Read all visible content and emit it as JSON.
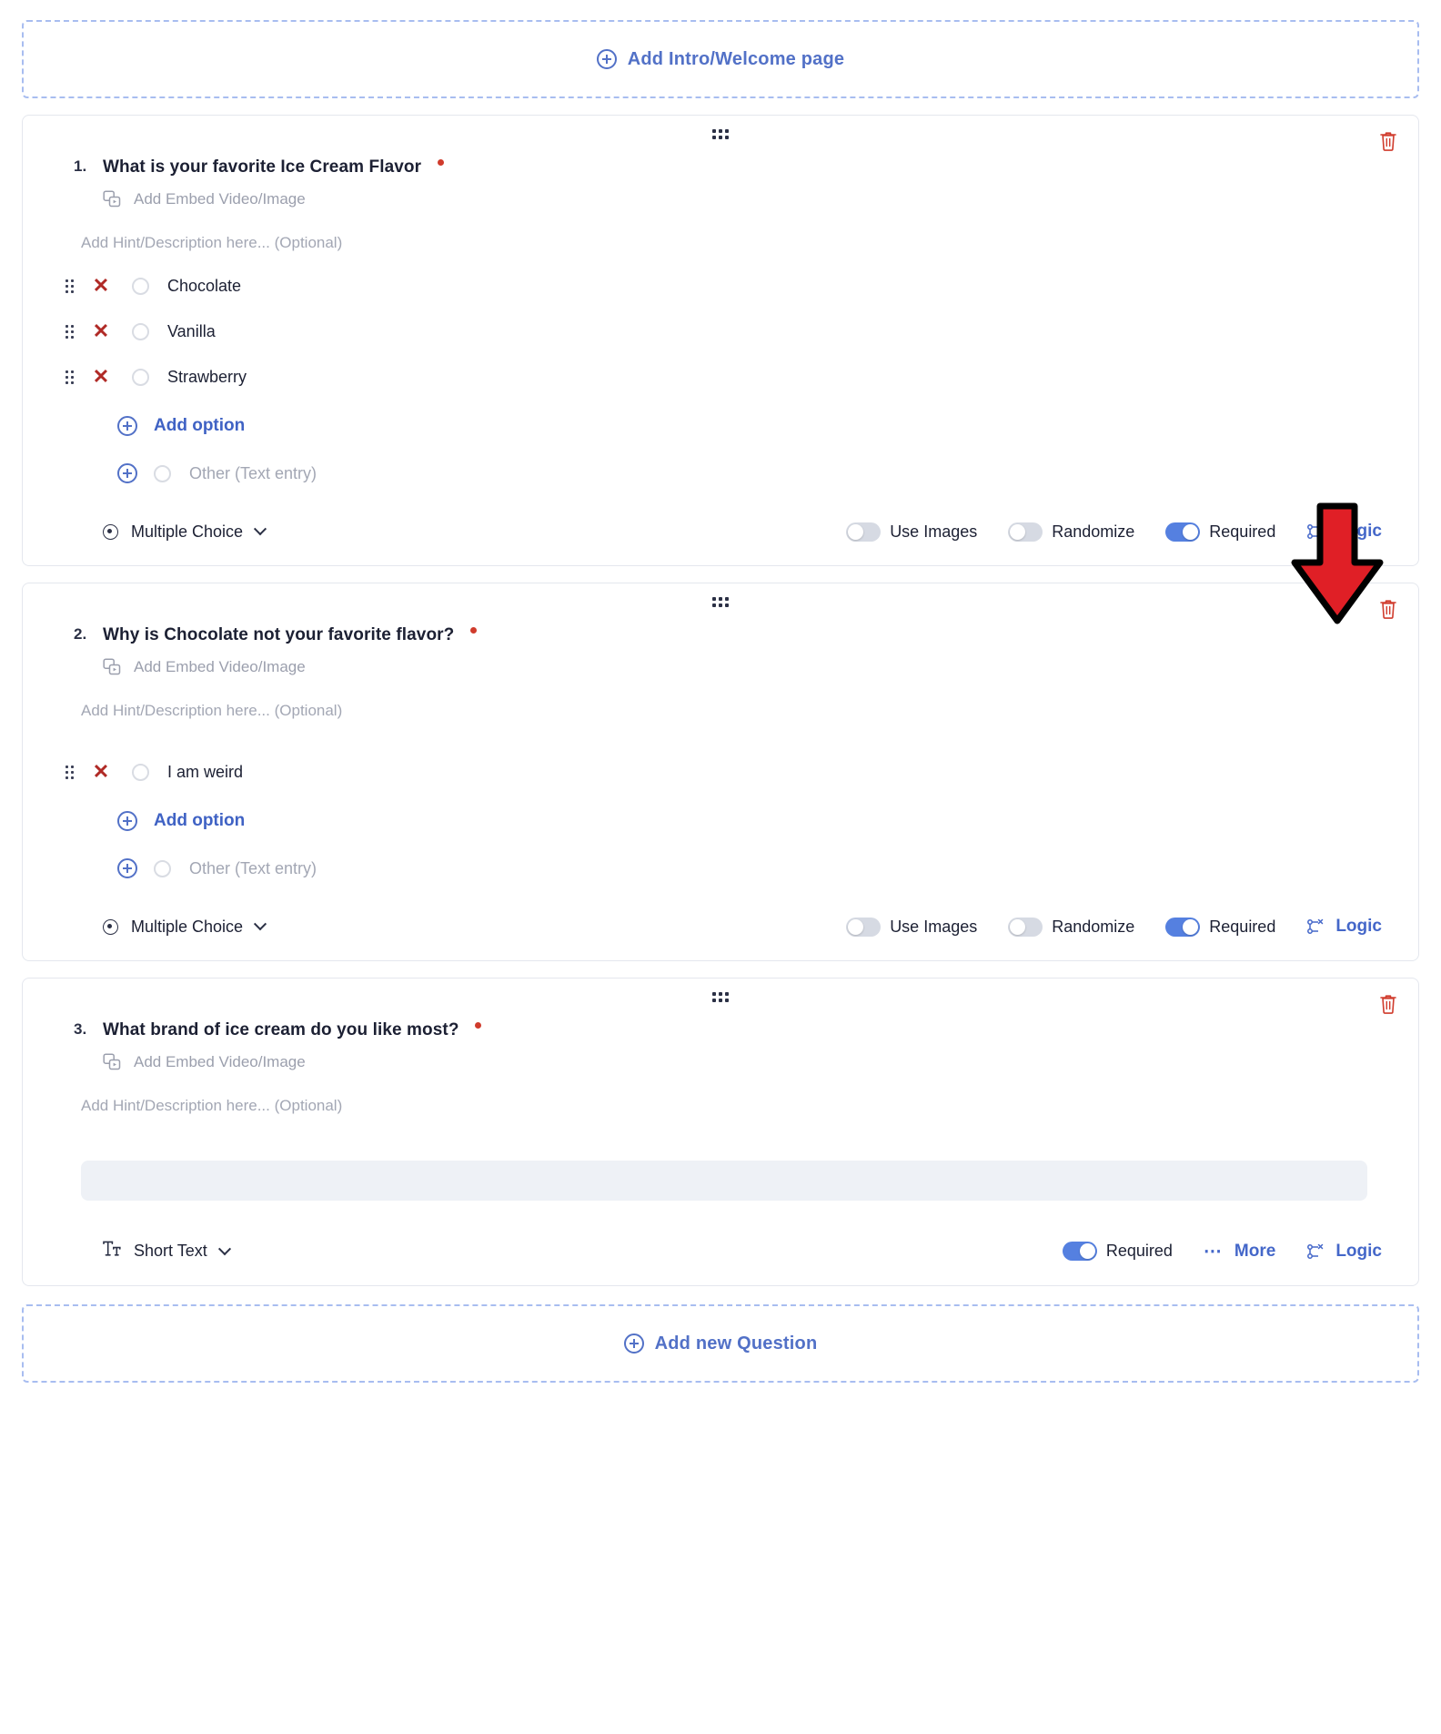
{
  "intro_bar": {
    "label": "Add Intro/Welcome page",
    "icon": "plus-circle-icon"
  },
  "footer_bar": {
    "label": "Add new Question",
    "icon": "plus-circle-icon"
  },
  "common": {
    "embed_label": "Add Embed Video/Image",
    "hint_placeholder": "Add Hint/Description here... (Optional)",
    "add_option_label": "Add option",
    "other_label": "Other (Text entry)",
    "use_images_label": "Use Images",
    "randomize_label": "Randomize",
    "required_label": "Required",
    "logic_label": "Logic",
    "more_label": "More",
    "drag_icon": "drag-handle-icon",
    "delete_icon": "trash-icon",
    "remove_option_icon": "close-x-icon",
    "logic_icon": "logic-branch-icon",
    "embed_icon": "media-embed-icon"
  },
  "colors": {
    "accent_blue": "#4467c9",
    "toggle_on": "#5580e0",
    "toggle_off": "#d6dae3",
    "required_dot": "#d03b2c",
    "remove_x": "#b02a26",
    "dashed_border": "#a8bdf0",
    "annotation_arrow": "#e01f26"
  },
  "questions": [
    {
      "number": "1.",
      "title": "What is your favorite Ice Cream Flavor",
      "required_marker": true,
      "type_label": "Multiple Choice",
      "type_icon": "radio-button-icon",
      "options": [
        {
          "label": "Chocolate"
        },
        {
          "label": "Vanilla"
        },
        {
          "label": "Strawberry"
        }
      ],
      "toggles": {
        "use_images": false,
        "randomize": false,
        "required": true
      },
      "has_more": false
    },
    {
      "number": "2.",
      "title": "Why is Chocolate not your favorite flavor?",
      "required_marker": true,
      "type_label": "Multiple Choice",
      "type_icon": "radio-button-icon",
      "options": [
        {
          "label": "I am weird"
        }
      ],
      "toggles": {
        "use_images": false,
        "randomize": false,
        "required": true
      },
      "has_more": false
    },
    {
      "number": "3.",
      "title": "What brand of ice cream do you like most?",
      "required_marker": true,
      "type_label": "Short Text",
      "type_icon": "short-text-icon",
      "options": [],
      "answer_field_value": "",
      "toggles": {
        "required": true
      },
      "has_more": true
    }
  ],
  "annotation": {
    "shape": "down-arrow",
    "points_to": "Logic"
  }
}
